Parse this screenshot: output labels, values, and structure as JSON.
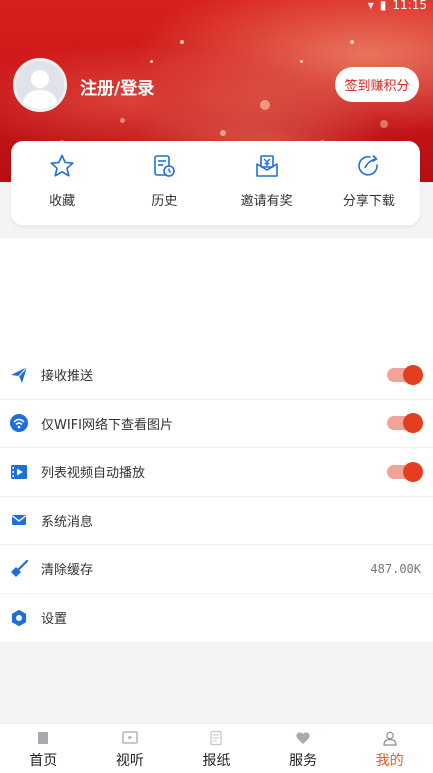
{
  "status_bar": {
    "time": "11:15"
  },
  "header": {
    "login_label": "注册/登录",
    "checkin_button": "签到赚积分",
    "accent_color": "#d42820"
  },
  "quick_actions": [
    {
      "label": "收藏",
      "icon": "star-icon"
    },
    {
      "label": "历史",
      "icon": "history-icon"
    },
    {
      "label": "邀请有奖",
      "icon": "invite-gift-icon"
    },
    {
      "label": "分享下载",
      "icon": "share-icon"
    }
  ],
  "settings": [
    {
      "label": "接收推送",
      "icon": "paper-plane-icon",
      "toggle": true
    },
    {
      "label": "仅WIFI网络下查看图片",
      "icon": "wifi-icon",
      "toggle": true
    },
    {
      "label": "列表视频自动播放",
      "icon": "video-icon",
      "toggle": true
    },
    {
      "label": "系统消息",
      "icon": "mail-icon"
    },
    {
      "label": "清除缓存",
      "icon": "broom-icon",
      "value": "487.00K"
    },
    {
      "label": "设置",
      "icon": "gear-icon"
    }
  ],
  "bottom_nav": [
    {
      "label": "首页",
      "icon": "home-icon"
    },
    {
      "label": "视听",
      "icon": "tv-icon"
    },
    {
      "label": "报纸",
      "icon": "newspaper-icon"
    },
    {
      "label": "服务",
      "icon": "heart-icon"
    },
    {
      "label": "我的",
      "icon": "profile-icon",
      "active": true
    }
  ],
  "colors": {
    "setting_icon_blue": "#1e6fd9",
    "toggle_on": "#e53d1f",
    "nav_active": "#ef5a2a"
  }
}
